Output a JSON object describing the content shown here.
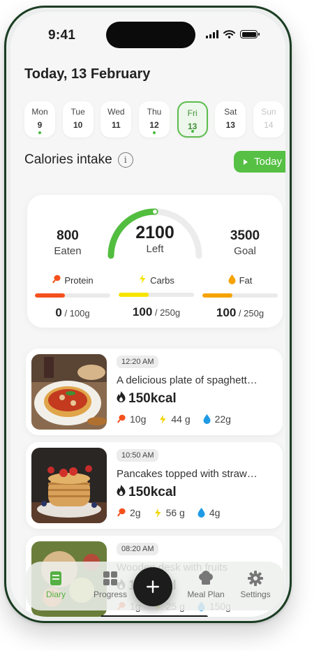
{
  "status": {
    "time": "9:41"
  },
  "header": {
    "date_title": "Today, 13 February"
  },
  "week": [
    {
      "name": "Mon",
      "num": "9",
      "dot": true,
      "state": "normal"
    },
    {
      "name": "Tue",
      "num": "10",
      "dot": false,
      "state": "normal"
    },
    {
      "name": "Wed",
      "num": "11",
      "dot": false,
      "state": "normal"
    },
    {
      "name": "Thu",
      "num": "12",
      "dot": true,
      "state": "normal"
    },
    {
      "name": "Fri",
      "num": "13",
      "dot": true,
      "state": "active"
    },
    {
      "name": "Sat",
      "num": "13",
      "dot": false,
      "state": "normal"
    },
    {
      "name": "Sun",
      "num": "14",
      "dot": false,
      "state": "future"
    }
  ],
  "calories": {
    "heading": "Calories intake",
    "info_icon": "i",
    "today_label": "Today",
    "eaten": {
      "value": "800",
      "label": "Eaten"
    },
    "left": {
      "value": "2100",
      "label": "Left"
    },
    "goal": {
      "value": "3500",
      "label": "Goal"
    },
    "gauge_progress": 0.5,
    "macros": [
      {
        "name": "Protein",
        "icon": "drumstick-icon",
        "amount": "0",
        "target": "/ 100g",
        "progress": 0.4,
        "color": "#f4511e"
      },
      {
        "name": "Carbs",
        "icon": "spark-icon",
        "amount": "100",
        "target": "/ 250g",
        "progress": 0.4,
        "color": "#f6e400"
      },
      {
        "name": "Fat",
        "icon": "drop-icon",
        "amount": "100",
        "target": "/ 250g",
        "progress": 0.4,
        "color": "#f5a300"
      }
    ]
  },
  "meals": [
    {
      "time": "12:20 AM",
      "title": "A delicious plate of spaghett…",
      "kcal": "150kcal",
      "protein": "10g",
      "carbs": "44 g",
      "fat": "22g"
    },
    {
      "time": "10:50 AM",
      "title": "Pancakes topped with straw…",
      "kcal": "150kcal",
      "protein": "2g",
      "carbs": "56 g",
      "fat": "4g"
    },
    {
      "time": "08:20 AM",
      "title": "Wooden desk with fruits",
      "kcal": "150kcal",
      "protein": "1g",
      "carbs": "25 g",
      "fat": "150g"
    }
  ],
  "nav": {
    "items": [
      {
        "label": "Diary",
        "icon": "diary-icon",
        "active": true
      },
      {
        "label": "Progress",
        "icon": "progress-icon",
        "active": false
      },
      {
        "label": "Meal Plan",
        "icon": "chef-hat-icon",
        "active": false
      },
      {
        "label": "Settings",
        "icon": "gear-icon",
        "active": false
      }
    ],
    "add_label": "+"
  },
  "colors": {
    "accent": "#55c043",
    "phone_frame": "#1b3d22"
  }
}
